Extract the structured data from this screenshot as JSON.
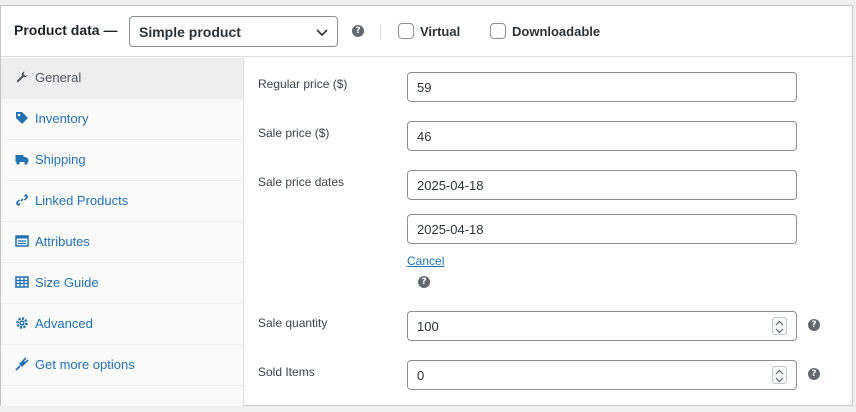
{
  "header": {
    "title": "Product data —",
    "product_type": "Simple product",
    "virtual_label": "Virtual",
    "downloadable_label": "Downloadable"
  },
  "sidebar": {
    "items": [
      {
        "label": "General",
        "icon": "wrench-icon",
        "active": true
      },
      {
        "label": "Inventory",
        "icon": "tag-icon"
      },
      {
        "label": "Shipping",
        "icon": "truck-icon"
      },
      {
        "label": "Linked Products",
        "icon": "link-icon"
      },
      {
        "label": "Attributes",
        "icon": "list-icon"
      },
      {
        "label": "Size Guide",
        "icon": "table-icon"
      },
      {
        "label": "Advanced",
        "icon": "gear-icon"
      },
      {
        "label": "Get more options",
        "icon": "plug-icon"
      }
    ]
  },
  "form": {
    "regular_price": {
      "label": "Regular price ($)",
      "value": "59"
    },
    "sale_price": {
      "label": "Sale price ($)",
      "value": "46"
    },
    "sale_dates": {
      "label": "Sale price dates",
      "from": "2025-04-18",
      "to": "2025-04-18",
      "cancel": "Cancel"
    },
    "sale_quantity": {
      "label": "Sale quantity",
      "value": "100"
    },
    "sold_items": {
      "label": "Sold Items",
      "value": "0"
    }
  },
  "colors": {
    "link": "#2271b1",
    "border": "#8c8f94",
    "help": "#646970"
  }
}
